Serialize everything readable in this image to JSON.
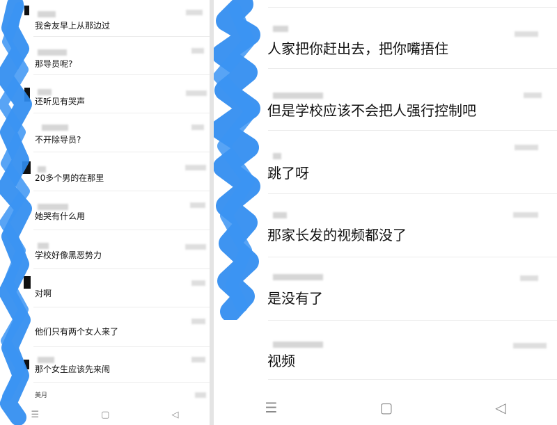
{
  "left_chat": {
    "messages": [
      {
        "text": "我舍友早上从那边过"
      },
      {
        "text": "那导员呢?"
      },
      {
        "text": "还听见有哭声"
      },
      {
        "text": "不开除导员?"
      },
      {
        "text": "20多个男的在那里"
      },
      {
        "text": "她哭有什么用"
      },
      {
        "text": "学校好像黑恶势力"
      },
      {
        "text": "对啊"
      },
      {
        "text": "他们只有两个女人来了"
      },
      {
        "text": "那个女生应该先来闹"
      }
    ],
    "partial_text": "美月"
  },
  "right_chat": {
    "messages": [
      {
        "text": "人家把你赶出去，把你嘴捂住"
      },
      {
        "text": "但是学校应该不会把人强行控制吧"
      },
      {
        "text": "跳了呀"
      },
      {
        "text": "那家长发的视频都没了"
      },
      {
        "text": "是没有了"
      },
      {
        "text": "视频"
      }
    ]
  },
  "navbar": {
    "menu_glyph": "☰",
    "home_glyph": "▢",
    "back_glyph": "◁"
  },
  "colors": {
    "scribble": "#2f8cf0",
    "background": "#ffffff",
    "separator": "#ececec"
  }
}
